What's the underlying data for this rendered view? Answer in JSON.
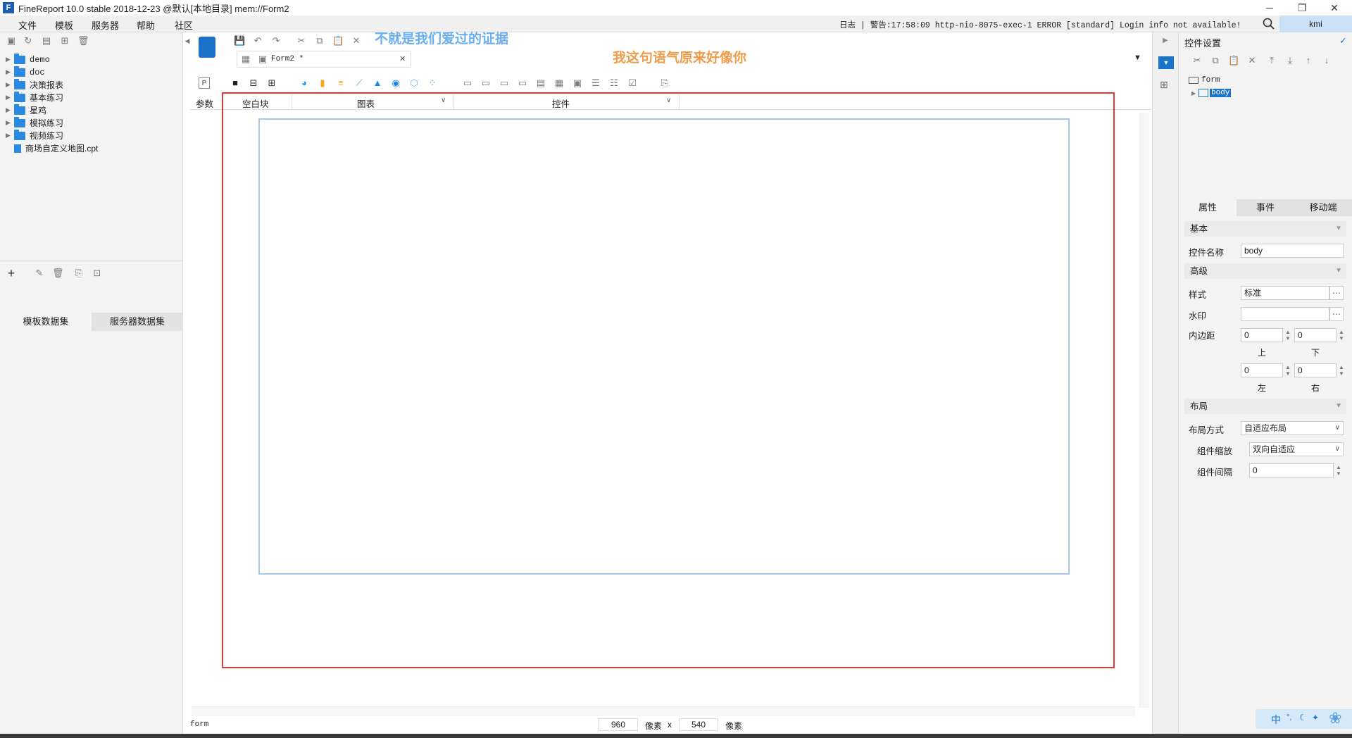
{
  "window": {
    "title": "FineReport 10.0 stable 2018-12-23 @默认[本地目录]    mem://Form2",
    "buttons": [
      "─",
      "❐",
      "✕"
    ]
  },
  "menubar": {
    "items": [
      "文件",
      "模板",
      "服务器",
      "帮助",
      "社区"
    ],
    "log": "日志 | 警告:17:58:09 http-nio-8075-exec-1 ERROR [standard] Login info not available!",
    "user": "kmi"
  },
  "left_panel": {
    "tree": [
      {
        "label": "demo",
        "type": "folder",
        "mono": true
      },
      {
        "label": "doc",
        "type": "folder",
        "mono": true
      },
      {
        "label": "决策报表",
        "type": "folder"
      },
      {
        "label": "基本练习",
        "type": "folder"
      },
      {
        "label": "星鸡",
        "type": "folder"
      },
      {
        "label": "模拟练习",
        "type": "folder"
      },
      {
        "label": "视频练习",
        "type": "folder"
      },
      {
        "label": "商场自定义地图.cpt",
        "type": "file"
      }
    ],
    "dataset_tabs": [
      "模板数据集",
      "服务器数据集"
    ]
  },
  "editor": {
    "tab_label": "Form2 *",
    "overlay_text_1": "不就是我们爱过的证据",
    "overlay_text_2": "我这句语气原来好像你",
    "param_label": "参数",
    "blank_block": "空白块",
    "chart_label": "图表",
    "widget_label": "控件",
    "status_name": "form",
    "width_value": "960",
    "height_value": "540",
    "unit": "像素",
    "times": "x"
  },
  "right_panel": {
    "title": "控件设置",
    "tree_root": "form",
    "tree_child": "body",
    "tabs": [
      "属性",
      "事件",
      "移动端"
    ],
    "sections": {
      "basic": "基本",
      "advanced": "高级",
      "layout": "布局"
    },
    "props": {
      "name_label": "控件名称",
      "name_value": "body",
      "style_label": "样式",
      "style_value": "标准",
      "watermark_label": "水印",
      "padding_label": "内边距",
      "top_value": "0",
      "bottom_value": "0",
      "left_value": "0",
      "right_value": "0",
      "top_label": "上",
      "bottom_label": "下",
      "left_label": "左",
      "right_label": "右",
      "layout_mode_label": "布局方式",
      "layout_mode_value": "自适应布局",
      "scale_label": "组件缩放",
      "scale_value": "双向自适应",
      "gap_label": "组件间隔",
      "gap_value": "0"
    }
  },
  "ime": {
    "label": "中"
  },
  "colors": {
    "accent": "#1a73c8",
    "highlight_red": "#e53935",
    "overlay_blue": "#6aaef0",
    "overlay_orange": "#ee9c4a"
  }
}
